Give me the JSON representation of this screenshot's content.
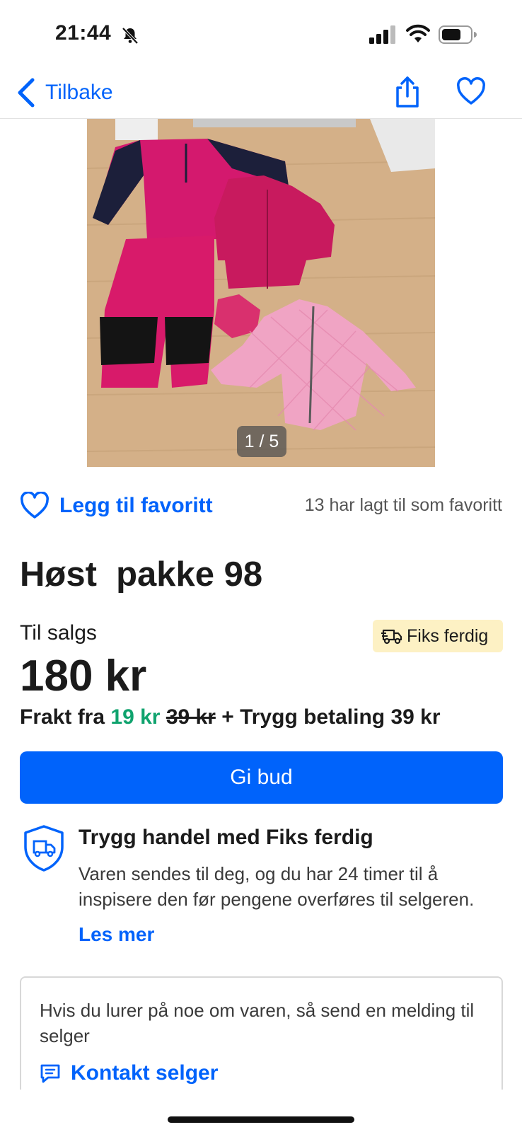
{
  "status_bar": {
    "time": "21:44"
  },
  "nav": {
    "back_label": "Tilbake"
  },
  "gallery": {
    "counter": "1 / 5"
  },
  "favorite": {
    "label": "Legg til favoritt",
    "count_text": "13 har lagt til som favoritt"
  },
  "listing": {
    "title": "Høst  pakke 98",
    "status": "Til salgs",
    "badge": "Fiks ferdig",
    "price": "180 kr",
    "shipping": {
      "prefix": "Frakt fra",
      "new_price": "19 kr",
      "old_price": "39 kr",
      "suffix": "+ Trygg betaling 39 kr"
    }
  },
  "actions": {
    "bid_label": "Gi bud"
  },
  "safe_trade": {
    "title": "Trygg handel med Fiks ferdig",
    "body": "Varen sendes til deg, og du har 24 timer til å inspisere den før pengene overføres til selgeren.",
    "link": "Les mer"
  },
  "contact": {
    "text": "Hvis du lurer på noe om varen, så send en melding til selger",
    "link": "Kontakt selger"
  },
  "colors": {
    "accent": "#0063fb",
    "discount_green": "#10a36e",
    "badge_bg": "#fdf1c4"
  }
}
